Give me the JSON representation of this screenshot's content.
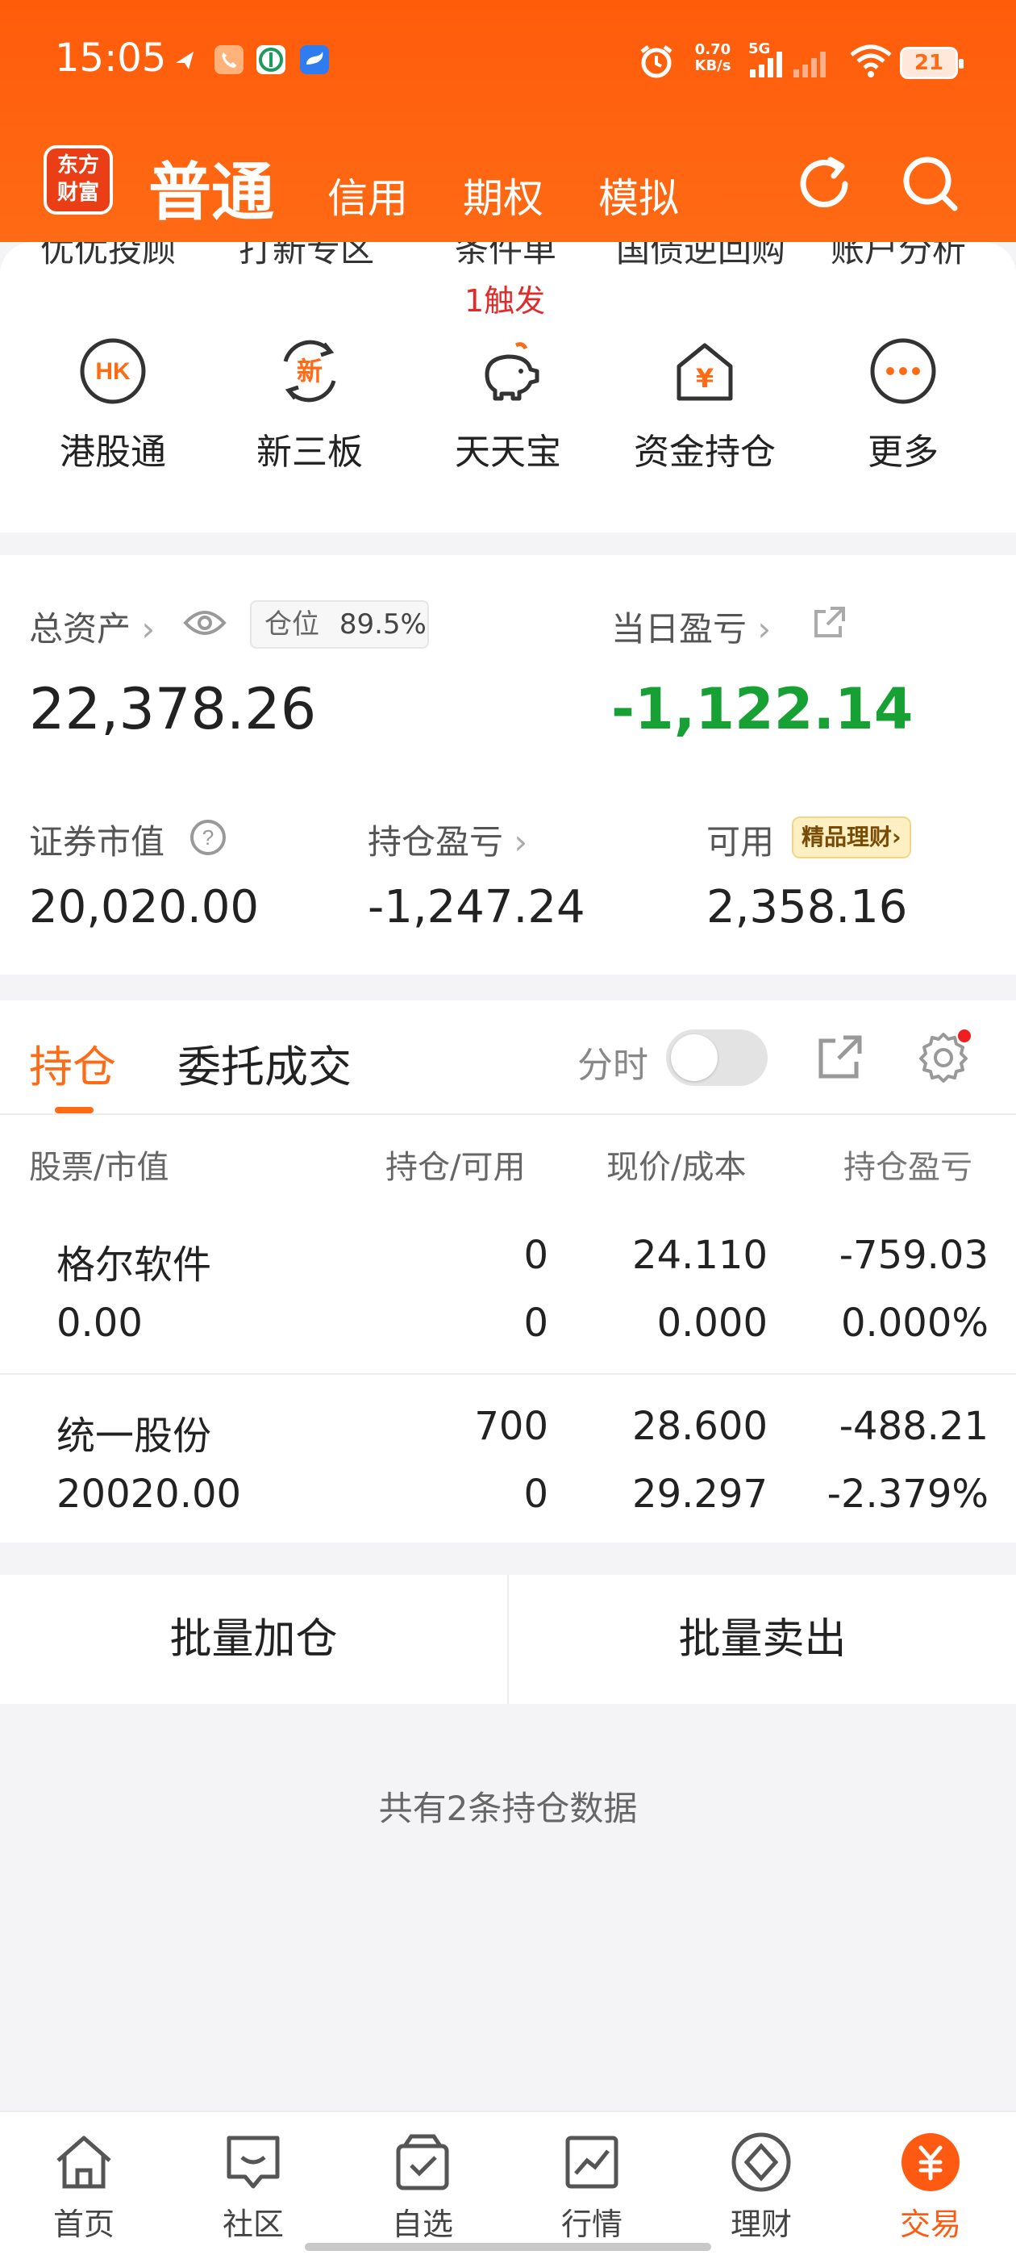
{
  "status_bar": {
    "time": "15:05",
    "net_speed_value": "0.70",
    "net_speed_unit": "KB/s",
    "network_type": "5G",
    "battery": "21",
    "icons": [
      "notification-app-icon",
      "phone-app-icon",
      "bank-app-icon",
      "cloud-app-icon",
      "alarm-icon",
      "signal-icon",
      "wifi-icon",
      "battery-icon"
    ]
  },
  "header": {
    "logo_line1": "东方",
    "logo_line2": "财富",
    "tabs": [
      "普通",
      "信用",
      "期权",
      "模拟"
    ],
    "icons": [
      "refresh-icon",
      "search-icon"
    ]
  },
  "peek_row": {
    "items": [
      "优优投顾",
      "打新专区",
      "条件单",
      "国债逆回购",
      "账户分析"
    ],
    "badge": "1触发"
  },
  "quick_functions": [
    {
      "label": "港股通",
      "icon": "hk-icon",
      "icon_text": "HK"
    },
    {
      "label": "新三板",
      "icon": "new-board-icon",
      "icon_text": "新"
    },
    {
      "label": "天天宝",
      "icon": "piggy-bank-icon",
      "icon_text": ""
    },
    {
      "label": "资金持仓",
      "icon": "yuan-house-icon",
      "icon_text": "¥"
    },
    {
      "label": "更多",
      "icon": "more-icon",
      "icon_text": ""
    }
  ],
  "assets": {
    "total_label": "总资产",
    "total_value": "22,378.26",
    "position_label": "仓位",
    "position_value": "89.5%",
    "daily_pl_label": "当日盈亏",
    "daily_pl_value": "-1,122.14",
    "market_value_label": "证券市值",
    "market_value": "20,020.00",
    "holding_pl_label": "持仓盈亏",
    "holding_pl_value": "-1,247.24",
    "available_label": "可用",
    "available_value": "2,358.16",
    "promo_tag": "精品理财"
  },
  "holdings": {
    "tabs": [
      "持仓",
      "委托成交"
    ],
    "toggle_label": "分时",
    "toggle_on": false,
    "columns": [
      "股票/市值",
      "持仓/可用",
      "现价/成本",
      "持仓盈亏"
    ],
    "rows": [
      {
        "name": "格尔软件",
        "market_value": "0.00",
        "holding": "0",
        "available": "0",
        "price": "24.110",
        "cost": "0.000",
        "pl": "-759.03",
        "pl_pct": "0.000%"
      },
      {
        "name": "统一股份",
        "market_value": "20020.00",
        "holding": "700",
        "available": "0",
        "price": "28.600",
        "cost": "29.297",
        "pl": "-488.21",
        "pl_pct": "-2.379%"
      }
    ],
    "batch_add": "批量加仓",
    "batch_sell": "批量卖出",
    "count_text": "共有2条持仓数据"
  },
  "bottom_nav": [
    {
      "label": "首页",
      "icon": "home-icon",
      "active": false
    },
    {
      "label": "社区",
      "icon": "community-icon",
      "active": false
    },
    {
      "label": "自选",
      "icon": "watchlist-icon",
      "active": false
    },
    {
      "label": "行情",
      "icon": "market-chart-icon",
      "active": false
    },
    {
      "label": "理财",
      "icon": "wealth-diamond-icon",
      "active": false
    },
    {
      "label": "交易",
      "icon": "trade-icon",
      "active": true
    }
  ],
  "colors": {
    "brand_orange": "#ff6a14",
    "loss_green": "#17a034",
    "alert_red": "#e02b2b"
  }
}
